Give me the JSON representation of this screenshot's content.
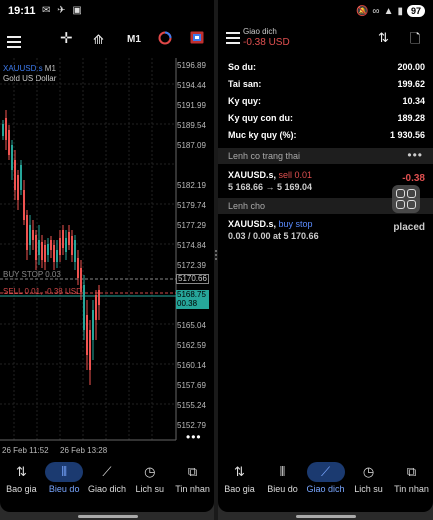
{
  "status": {
    "time": "19:11",
    "battery": "97"
  },
  "left": {
    "toolbar": {
      "timeframe": "M1"
    },
    "symbol": {
      "name": "XAUUSD.s",
      "tf": "M1",
      "description": "Gold US Dollar"
    },
    "y_labels": [
      "5196.89",
      "5194.44",
      "5191.99",
      "5189.54",
      "5187.09",
      "5182.19",
      "5179.74",
      "5177.29",
      "5174.84",
      "5172.39",
      "5170.66",
      "5168.75",
      "5165.04",
      "5162.59",
      "5160.14",
      "5157.69",
      "5155.24",
      "5152.79"
    ],
    "x_labels": [
      "26 Feb 11:52",
      "26 Feb 13:28"
    ],
    "buy_stop_label": "BUY STOP 0.03",
    "sell_label": "SELL 0.01, -0.38 USD",
    "tag_buy": "5170.66",
    "tag_ask": "5168.75",
    "tag_bid": "00.38",
    "nav": [
      {
        "label": "Bao gia",
        "icon": "⇅"
      },
      {
        "label": "Bieu do",
        "icon": "⫴"
      },
      {
        "label": "Giao dich",
        "icon": "⟋"
      },
      {
        "label": "Lich su",
        "icon": "◷"
      },
      {
        "label": "Tin nhan",
        "icon": "⧉"
      }
    ]
  },
  "right": {
    "title": "Giao dich",
    "subtitle": "-0.38 USD",
    "account": [
      {
        "label": "So du:",
        "value": "200.00"
      },
      {
        "label": "Tai san:",
        "value": "199.62"
      },
      {
        "label": "Ky quy:",
        "value": "10.34"
      },
      {
        "label": "Ky quy con du:",
        "value": "189.28"
      },
      {
        "label": "Muc ky quy (%):",
        "value": "1 930.56"
      }
    ],
    "open_section": "Lenh co trang thai",
    "open_pos": {
      "symbol": "XAUUSD.s,",
      "side": "sell 0.01",
      "prices": "5 168.66 → 5 169.04",
      "pl": "-0.38"
    },
    "pending_section": "Lenh cho",
    "pending": {
      "symbol": "XAUUSD.s,",
      "side": "buy stop",
      "detail": "0.03 / 0.00 at 5 170.66",
      "status": "placed"
    },
    "nav": [
      {
        "label": "Bao gia",
        "icon": "⇅"
      },
      {
        "label": "Bieu do",
        "icon": "⫴"
      },
      {
        "label": "Giao dich",
        "icon": "⟋"
      },
      {
        "label": "Lich su",
        "icon": "◷"
      },
      {
        "label": "Tin nhan",
        "icon": "⧉"
      }
    ]
  }
}
